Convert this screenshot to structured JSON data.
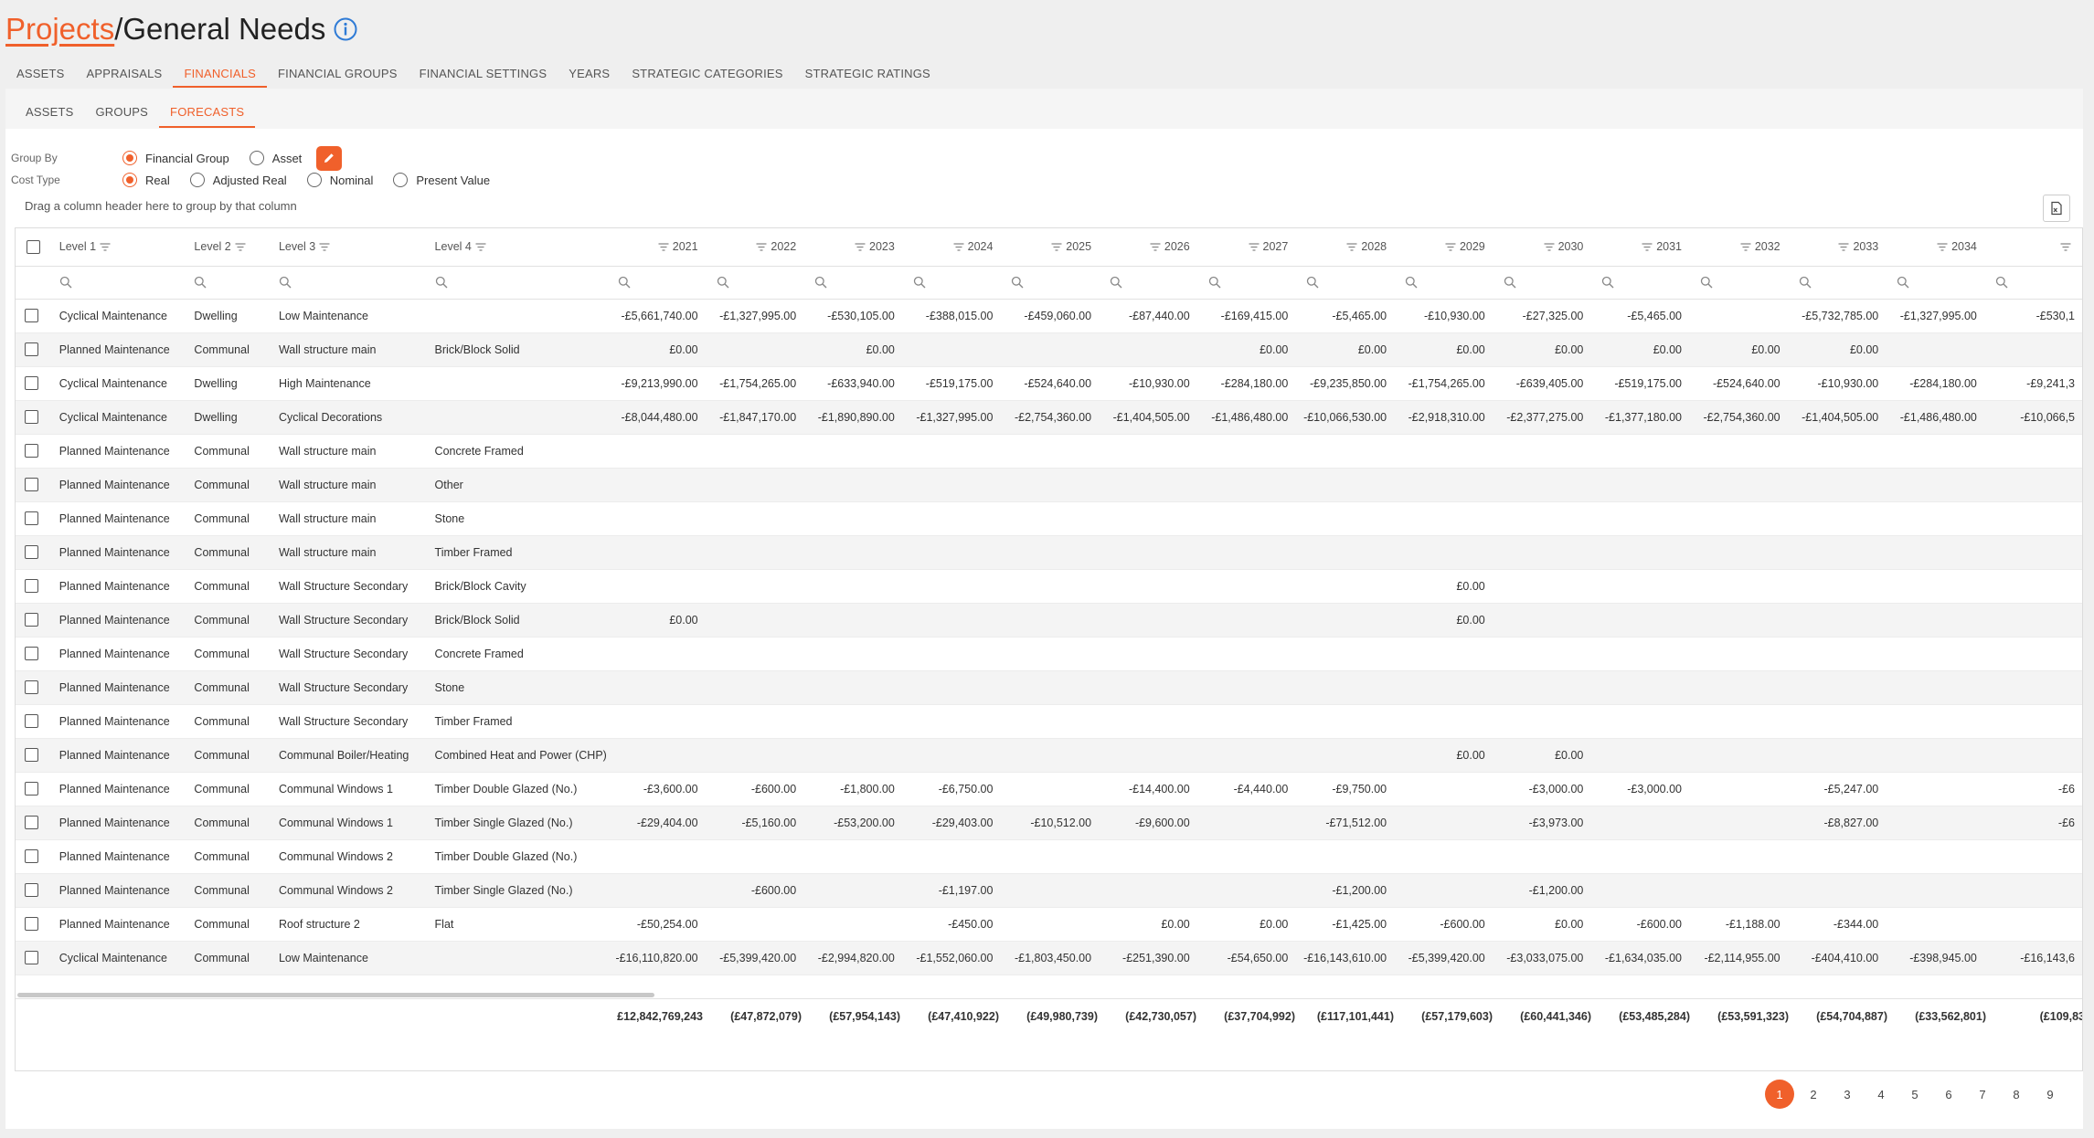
{
  "header": {
    "breadcrumb_link": "Projects",
    "breadcrumb_rest": "/General Needs"
  },
  "main_tabs": [
    "ASSETS",
    "APPRAISALS",
    "FINANCIALS",
    "FINANCIAL GROUPS",
    "FINANCIAL SETTINGS",
    "YEARS",
    "STRATEGIC CATEGORIES",
    "STRATEGIC RATINGS"
  ],
  "main_tabs_active": "FINANCIALS",
  "sub_tabs": [
    "ASSETS",
    "GROUPS",
    "FORECASTS"
  ],
  "sub_tabs_active": "FORECASTS",
  "options": {
    "group_by_label": "Group By",
    "group_by": [
      "Financial Group",
      "Asset"
    ],
    "group_by_selected": "Financial Group",
    "cost_type_label": "Cost Type",
    "cost_type": [
      "Real",
      "Adjusted Real",
      "Nominal",
      "Present Value"
    ],
    "cost_type_selected": "Real"
  },
  "drag_hint": "Drag a column header here to group by that column",
  "grid": {
    "headers": [
      "Level 1",
      "Level 2",
      "Level 3",
      "Level 4"
    ],
    "years": [
      "2021",
      "2022",
      "2023",
      "2024",
      "2025",
      "2026",
      "2027",
      "2028",
      "2029",
      "2030",
      "2031",
      "2032",
      "2033",
      "2034"
    ],
    "rows": [
      {
        "l1": "Cyclical Maintenance",
        "l2": "Dwelling",
        "l3": "Low Maintenance",
        "l4": "",
        "v": [
          "-£5,661,740.00",
          "-£1,327,995.00",
          "-£530,105.00",
          "-£388,015.00",
          "-£459,060.00",
          "-£87,440.00",
          "-£169,415.00",
          "-£5,465.00",
          "-£10,930.00",
          "-£27,325.00",
          "-£5,465.00",
          "",
          "-£5,732,785.00",
          "-£1,327,995.00",
          "-£530,1"
        ]
      },
      {
        "l1": "Planned Maintenance",
        "l2": "Communal",
        "l3": "Wall structure main",
        "l4": "Brick/Block Solid",
        "v": [
          "£0.00",
          "",
          "£0.00",
          "",
          "",
          "",
          "£0.00",
          "£0.00",
          "£0.00",
          "£0.00",
          "£0.00",
          "£0.00",
          "£0.00",
          "",
          ""
        ]
      },
      {
        "l1": "Cyclical Maintenance",
        "l2": "Dwelling",
        "l3": "High Maintenance",
        "l4": "",
        "v": [
          "-£9,213,990.00",
          "-£1,754,265.00",
          "-£633,940.00",
          "-£519,175.00",
          "-£524,640.00",
          "-£10,930.00",
          "-£284,180.00",
          "-£9,235,850.00",
          "-£1,754,265.00",
          "-£639,405.00",
          "-£519,175.00",
          "-£524,640.00",
          "-£10,930.00",
          "-£284,180.00",
          "-£9,241,3"
        ]
      },
      {
        "l1": "Cyclical Maintenance",
        "l2": "Dwelling",
        "l3": "Cyclical Decorations",
        "l4": "",
        "v": [
          "-£8,044,480.00",
          "-£1,847,170.00",
          "-£1,890,890.00",
          "-£1,327,995.00",
          "-£2,754,360.00",
          "-£1,404,505.00",
          "-£1,486,480.00",
          "-£10,066,530.00",
          "-£2,918,310.00",
          "-£2,377,275.00",
          "-£1,377,180.00",
          "-£2,754,360.00",
          "-£1,404,505.00",
          "-£1,486,480.00",
          "-£10,066,5"
        ]
      },
      {
        "l1": "Planned Maintenance",
        "l2": "Communal",
        "l3": "Wall structure main",
        "l4": "Concrete Framed",
        "v": []
      },
      {
        "l1": "Planned Maintenance",
        "l2": "Communal",
        "l3": "Wall structure main",
        "l4": "Other",
        "v": []
      },
      {
        "l1": "Planned Maintenance",
        "l2": "Communal",
        "l3": "Wall structure main",
        "l4": "Stone",
        "v": []
      },
      {
        "l1": "Planned Maintenance",
        "l2": "Communal",
        "l3": "Wall structure main",
        "l4": "Timber Framed",
        "v": []
      },
      {
        "l1": "Planned Maintenance",
        "l2": "Communal",
        "l3": "Wall Structure Secondary",
        "l4": "Brick/Block Cavity",
        "v": [
          "",
          "",
          "",
          "",
          "",
          "",
          "",
          "",
          "£0.00",
          "",
          "",
          "",
          "",
          "",
          ""
        ]
      },
      {
        "l1": "Planned Maintenance",
        "l2": "Communal",
        "l3": "Wall Structure Secondary",
        "l4": "Brick/Block Solid",
        "v": [
          "£0.00",
          "",
          "",
          "",
          "",
          "",
          "",
          "",
          "£0.00",
          "",
          "",
          "",
          "",
          "",
          ""
        ]
      },
      {
        "l1": "Planned Maintenance",
        "l2": "Communal",
        "l3": "Wall Structure Secondary",
        "l4": "Concrete Framed",
        "v": []
      },
      {
        "l1": "Planned Maintenance",
        "l2": "Communal",
        "l3": "Wall Structure Secondary",
        "l4": "Stone",
        "v": []
      },
      {
        "l1": "Planned Maintenance",
        "l2": "Communal",
        "l3": "Wall Structure Secondary",
        "l4": "Timber Framed",
        "v": []
      },
      {
        "l1": "Planned Maintenance",
        "l2": "Communal",
        "l3": "Communal Boiler/Heating",
        "l4": "Combined Heat and Power (CHP)",
        "v": [
          "",
          "",
          "",
          "",
          "",
          "",
          "",
          "",
          "£0.00",
          "£0.00",
          "",
          "",
          "",
          "",
          ""
        ]
      },
      {
        "l1": "Planned Maintenance",
        "l2": "Communal",
        "l3": "Communal Windows 1",
        "l4": "Timber Double Glazed (No.)",
        "v": [
          "-£3,600.00",
          "-£600.00",
          "-£1,800.00",
          "-£6,750.00",
          "",
          "-£14,400.00",
          "-£4,440.00",
          "-£9,750.00",
          "",
          "-£3,000.00",
          "-£3,000.00",
          "",
          "-£5,247.00",
          "",
          "-£6"
        ]
      },
      {
        "l1": "Planned Maintenance",
        "l2": "Communal",
        "l3": "Communal Windows 1",
        "l4": "Timber Single Glazed (No.)",
        "v": [
          "-£29,404.00",
          "-£5,160.00",
          "-£53,200.00",
          "-£29,403.00",
          "-£10,512.00",
          "-£9,600.00",
          "",
          "-£71,512.00",
          "",
          "-£3,973.00",
          "",
          "",
          "-£8,827.00",
          "",
          "-£6"
        ]
      },
      {
        "l1": "Planned Maintenance",
        "l2": "Communal",
        "l3": "Communal Windows 2",
        "l4": "Timber Double Glazed (No.)",
        "v": []
      },
      {
        "l1": "Planned Maintenance",
        "l2": "Communal",
        "l3": "Communal Windows 2",
        "l4": "Timber Single Glazed (No.)",
        "v": [
          "",
          "-£600.00",
          "",
          "-£1,197.00",
          "",
          "",
          "",
          "-£1,200.00",
          "",
          "-£1,200.00",
          "",
          "",
          "",
          "",
          ""
        ]
      },
      {
        "l1": "Planned Maintenance",
        "l2": "Communal",
        "l3": "Roof structure 2",
        "l4": "Flat",
        "v": [
          "-£50,254.00",
          "",
          "",
          "-£450.00",
          "",
          "£0.00",
          "£0.00",
          "-£1,425.00",
          "-£600.00",
          "£0.00",
          "-£600.00",
          "-£1,188.00",
          "-£344.00",
          "",
          ""
        ]
      },
      {
        "l1": "Cyclical Maintenance",
        "l2": "Communal",
        "l3": "Low Maintenance",
        "l4": "",
        "v": [
          "-£16,110,820.00",
          "-£5,399,420.00",
          "-£2,994,820.00",
          "-£1,552,060.00",
          "-£1,803,450.00",
          "-£251,390.00",
          "-£54,650.00",
          "-£16,143,610.00",
          "-£5,399,420.00",
          "-£3,033,075.00",
          "-£1,634,035.00",
          "-£2,114,955.00",
          "-£404,410.00",
          "-£398,945.00",
          "-£16,143,6"
        ]
      }
    ],
    "totals": [
      "£12,842,769,243",
      "(£47,872,079)",
      "(£57,954,143)",
      "(£47,410,922)",
      "(£49,980,739)",
      "(£42,730,057)",
      "(£37,704,992)",
      "(£117,101,441)",
      "(£57,179,603)",
      "(£60,441,346)",
      "(£53,485,284)",
      "(£53,591,323)",
      "(£54,704,887)",
      "(£33,562,801)",
      "(£109,83"
    ]
  },
  "pager": {
    "pages": [
      "1",
      "2",
      "3",
      "4",
      "5",
      "6",
      "7",
      "8",
      "9"
    ],
    "active": "1"
  },
  "colors": {
    "accent": "#f0602b",
    "info": "#2f7bd6"
  }
}
